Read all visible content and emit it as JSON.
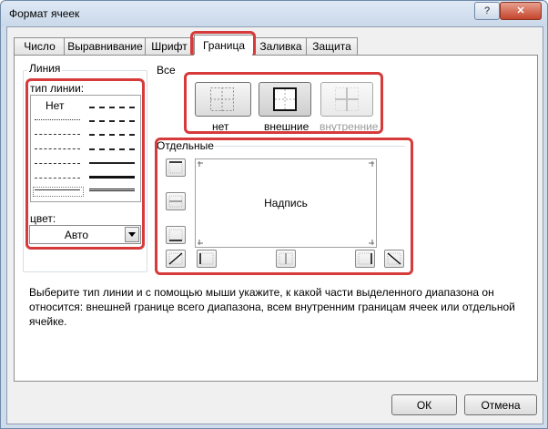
{
  "window": {
    "title": "Формат ячеек",
    "help_label": "?",
    "close_label": "✕"
  },
  "tabs": [
    {
      "label": "Число"
    },
    {
      "label": "Выравнивание"
    },
    {
      "label": "Шрифт"
    },
    {
      "label": "Граница",
      "active": true
    },
    {
      "label": "Заливка"
    },
    {
      "label": "Защита"
    }
  ],
  "line_group": {
    "title": "Линия",
    "type_label": "тип линии:",
    "none_label": "Нет",
    "color_label": "цвет:",
    "color_value": "Авто"
  },
  "presets": {
    "title": "Все",
    "none_label": "нет",
    "outline_label": "внешние",
    "inside_label": "внутренние"
  },
  "border": {
    "title": "Отдельные",
    "preview_text": "Надпись"
  },
  "description": "Выберите тип линии и с помощью мыши укажите, к какой части выделенного диапазона он относится: внешней границе всего диапазона, всем внутренним границам ячеек или отдельной ячейке.",
  "buttons": {
    "ok": "ОК",
    "cancel": "Отмена"
  },
  "colors": {
    "highlight": "#d63a3a",
    "window_frame": "#cfdcec"
  }
}
